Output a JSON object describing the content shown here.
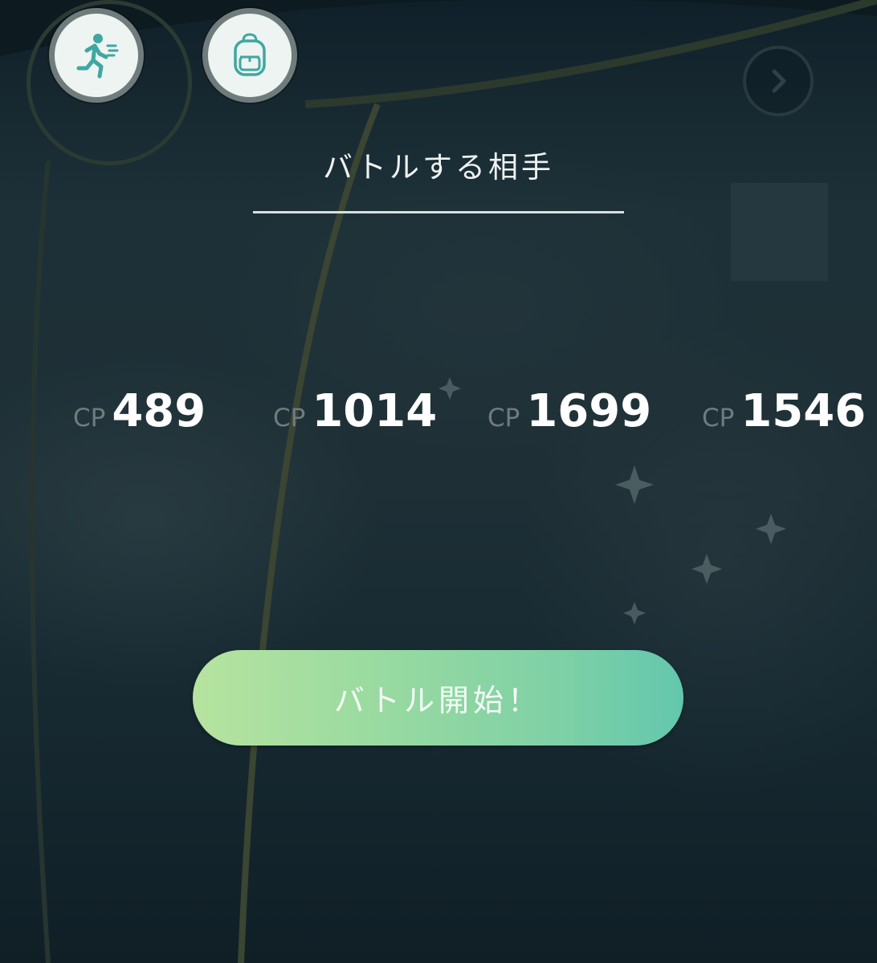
{
  "header": {
    "run_icon": "running-person-icon",
    "bag_icon": "backpack-icon",
    "next_icon": "chevron-right-icon"
  },
  "opponents": {
    "title": "バトルする相手",
    "cp_label": "CP",
    "items": [
      {
        "cp": "489"
      },
      {
        "cp": "1014"
      },
      {
        "cp": "1699"
      },
      {
        "cp": "1546"
      }
    ]
  },
  "actions": {
    "start_label": "バトル開始！"
  },
  "colors": {
    "background": "#14252b",
    "button_gradient_start": "#b7e39f",
    "button_gradient_end": "#63c7ad",
    "icon_teal": "#3fa7a1"
  }
}
